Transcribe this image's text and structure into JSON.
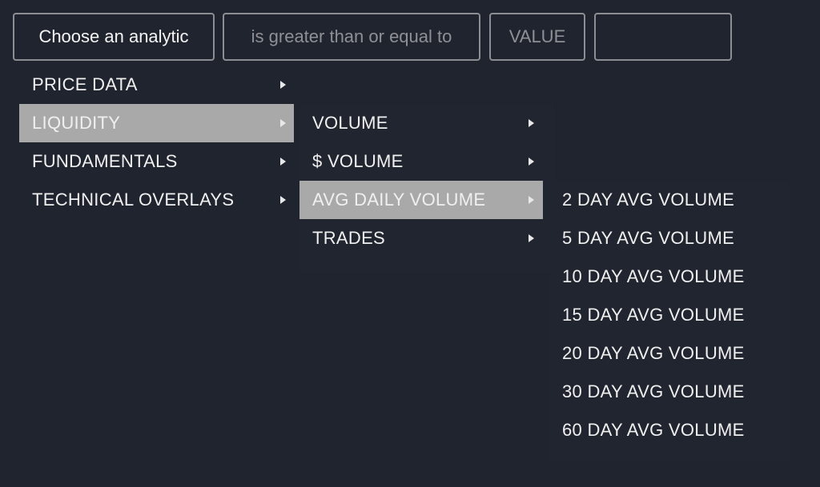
{
  "toolbar": {
    "analytic_label": "Choose an analytic",
    "operator_label": "is greater than or equal to",
    "value_type_label": "VALUE",
    "value_input": "",
    "value_placeholder": ""
  },
  "colors": {
    "background": "#20242e",
    "highlight": "#a9a9aa",
    "text": "#f0f0f0",
    "muted_text": "#8e9095",
    "border": "#8c8e93"
  },
  "menu_level1": {
    "items": [
      {
        "label": "PRICE DATA",
        "has_submenu": true,
        "active": false
      },
      {
        "label": "LIQUIDITY",
        "has_submenu": true,
        "active": true
      },
      {
        "label": "FUNDAMENTALS",
        "has_submenu": true,
        "active": false
      },
      {
        "label": "TECHNICAL OVERLAYS",
        "has_submenu": true,
        "active": false
      }
    ]
  },
  "menu_level2": {
    "items": [
      {
        "label": "VOLUME",
        "has_submenu": true,
        "active": false
      },
      {
        "label": "$ VOLUME",
        "has_submenu": true,
        "active": false
      },
      {
        "label": "AVG DAILY VOLUME",
        "has_submenu": true,
        "active": true
      },
      {
        "label": "TRADES",
        "has_submenu": true,
        "active": false
      }
    ]
  },
  "menu_level3": {
    "items": [
      {
        "label": "2 DAY AVG VOLUME"
      },
      {
        "label": "5 DAY AVG VOLUME"
      },
      {
        "label": "10 DAY AVG VOLUME"
      },
      {
        "label": "15 DAY AVG VOLUME"
      },
      {
        "label": "20 DAY AVG VOLUME"
      },
      {
        "label": "30 DAY AVG VOLUME"
      },
      {
        "label": "60 DAY AVG VOLUME"
      }
    ]
  }
}
